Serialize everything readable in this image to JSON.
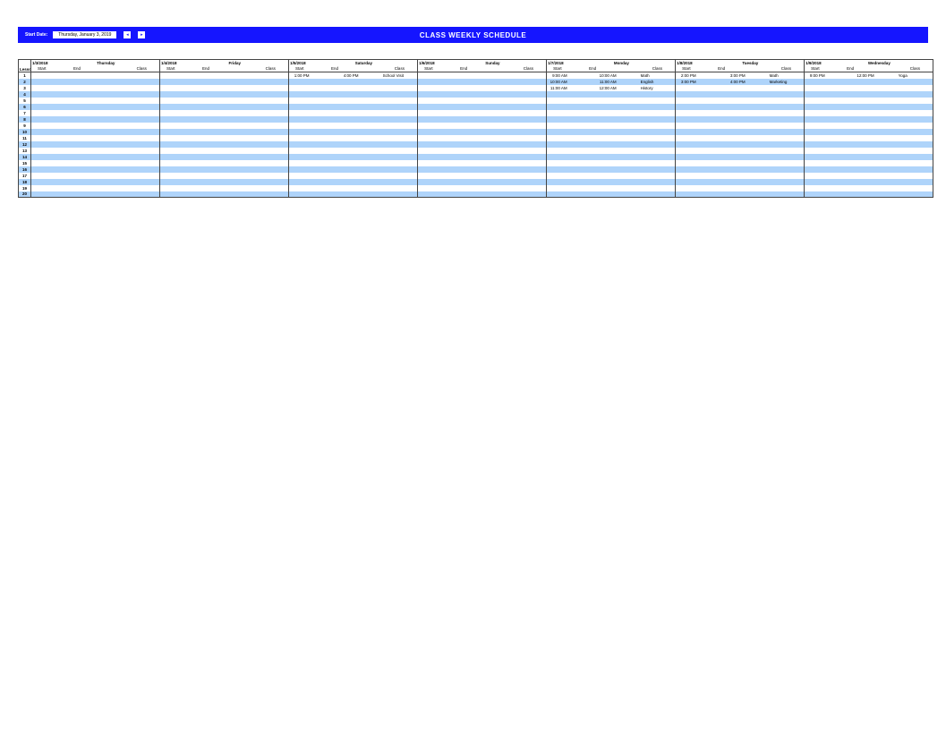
{
  "header": {
    "start_date_label": "Start Date:",
    "start_date_value": "Thursday, January 3, 2019",
    "title": "CLASS WEEKLY SCHEDULE"
  },
  "labels": {
    "lesson": "Lesson",
    "start": "Start",
    "end": "End",
    "class": "Class"
  },
  "days": [
    {
      "date": "1/3/2018",
      "name": "Thursday"
    },
    {
      "date": "1/4/2018",
      "name": "Friday"
    },
    {
      "date": "1/5/2018",
      "name": "Saturday"
    },
    {
      "date": "1/6/2018",
      "name": "Sunday"
    },
    {
      "date": "1/7/2018",
      "name": "Monday"
    },
    {
      "date": "1/8/2018",
      "name": "Tuesday"
    },
    {
      "date": "1/9/2018",
      "name": "Wednesday"
    }
  ],
  "rowCount": 20,
  "entries": {
    "1": {
      "2": {
        "start": "1:00 PM",
        "end": "4:00 PM",
        "class": "School Visit"
      },
      "4": {
        "start": "9:00 AM",
        "end": "10:00 AM",
        "class": "Math"
      },
      "5": {
        "start": "2:00 PM",
        "end": "3:00 PM",
        "class": "Math"
      },
      "6": {
        "start": "9:00 PM",
        "end": "12:00 PM",
        "class": "Yoga"
      }
    },
    "2": {
      "4": {
        "start": "10:00 AM",
        "end": "11:00 AM",
        "class": "English"
      },
      "5": {
        "start": "3:00 PM",
        "end": "4:00 PM",
        "class": "Marketing"
      }
    },
    "3": {
      "4": {
        "start": "11:00 AM",
        "end": "12:00 AM",
        "class": "History"
      }
    }
  }
}
